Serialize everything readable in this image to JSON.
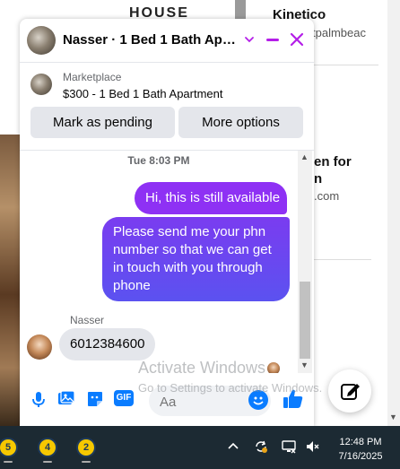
{
  "background": {
    "house_text": "HOUSE",
    "advertiser": "Kinetico",
    "advertiser_link": "tpalmbeac",
    "article_title_lines": [
      "en for",
      "n"
    ],
    "article_link": ".com"
  },
  "chat": {
    "title": "Nasser · 1 Bed 1 Bath Apart...",
    "marketplace": {
      "label": "Marketplace",
      "listing": "$300 - 1 Bed 1 Bath Apartment",
      "pending_button": "Mark as pending",
      "more_button": "More options"
    },
    "timestamp": "Tue 8:03 PM",
    "messages": [
      {
        "from": "me",
        "text": "Hi, this is still available"
      },
      {
        "from": "me",
        "text": "Please send me your phn number so that we can get in touch with you through phone"
      },
      {
        "from": "Nasser",
        "sender_label": "Nasser",
        "text": "6012384600"
      }
    ],
    "composer": {
      "placeholder": "Aa",
      "gif_label": "GIF"
    }
  },
  "watermark": {
    "line1": "Activate Windows",
    "line2": "Go to Settings to activate Windows."
  },
  "taskbar": {
    "apps": [
      {
        "badge": "5"
      },
      {
        "badge": "4"
      },
      {
        "badge": "2"
      }
    ],
    "clock": {
      "time": "12:48 PM",
      "date": "7/16/2025"
    }
  },
  "colors": {
    "accent": "#8e31f4",
    "gradient_bubble": "#5b52f0",
    "messenger_blue": "#0a7cff",
    "taskbar": "#1c2a33"
  }
}
